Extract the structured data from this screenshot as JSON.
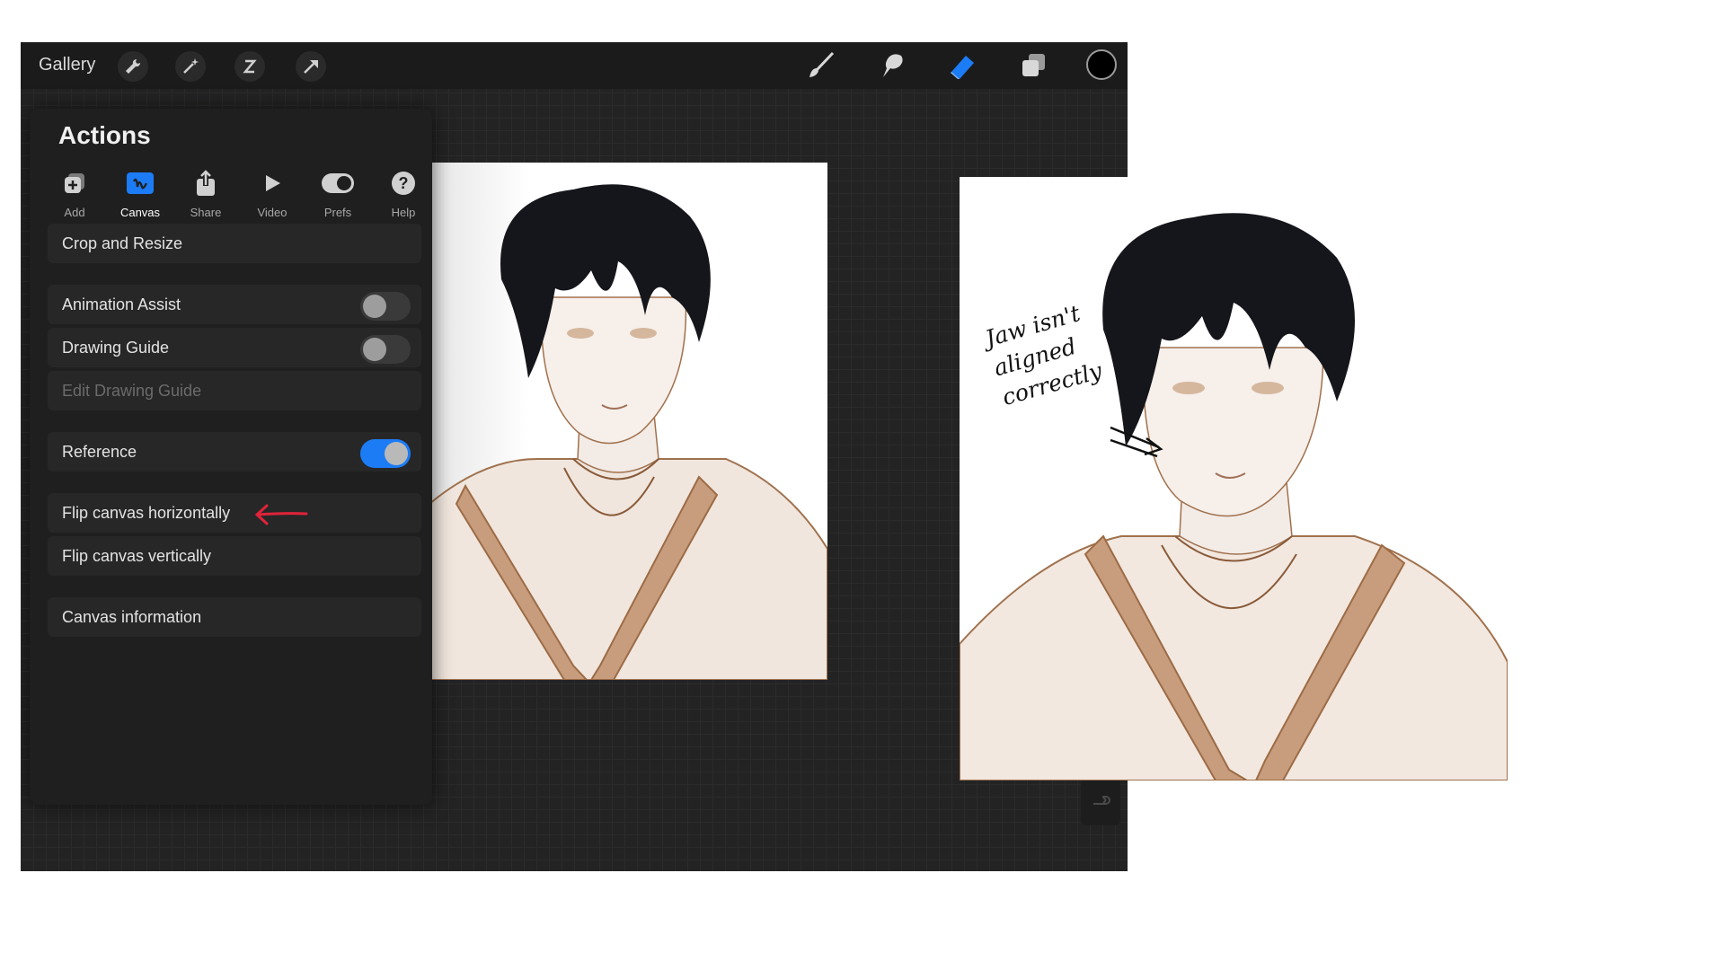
{
  "topbar": {
    "gallery_label": "Gallery",
    "left_tools": [
      "wrench-icon",
      "magic-wand-icon",
      "selection-icon",
      "transform-arrow-icon"
    ],
    "right_tools": [
      "brush-icon",
      "smudge-icon",
      "eraser-icon",
      "layers-icon"
    ],
    "current_color": "#000000"
  },
  "actions": {
    "title": "Actions",
    "tabs": [
      {
        "label": "Add",
        "icon": "add-icon"
      },
      {
        "label": "Canvas",
        "icon": "canvas-icon"
      },
      {
        "label": "Share",
        "icon": "share-icon"
      },
      {
        "label": "Video",
        "icon": "play-icon"
      },
      {
        "label": "Prefs",
        "icon": "toggle-icon"
      },
      {
        "label": "Help",
        "icon": "help-icon"
      }
    ],
    "active_tab": "Canvas",
    "items": {
      "crop": "Crop and Resize",
      "animation": "Animation Assist",
      "drawing_guide": "Drawing Guide",
      "edit_guide": "Edit Drawing Guide",
      "reference": "Reference",
      "flip_h": "Flip canvas horizontally",
      "flip_v": "Flip canvas vertically",
      "canvas_info": "Canvas information"
    },
    "toggles": {
      "animation_assist": false,
      "drawing_guide": false,
      "reference": true
    }
  },
  "annotation": {
    "lines": [
      "Jaw isn't",
      "aligned",
      "correctly"
    ]
  },
  "colors": {
    "accent": "#1c7cf5",
    "arrow": "#e0233a",
    "sketch": "#9c6b45",
    "hair": "#15161b"
  }
}
